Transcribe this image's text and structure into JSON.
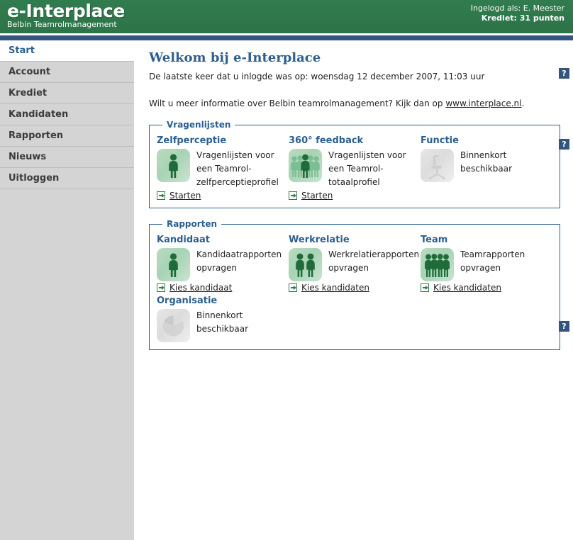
{
  "header": {
    "brand_title": "e-Interplace",
    "brand_subtitle": "Belbin Teamrolmanagement",
    "session_user": "Ingelogd als: E. Meester",
    "session_credit": "Krediet: 31 punten",
    "accent_green": "#2f7a4d",
    "accent_blue": "#33557f"
  },
  "sidebar": {
    "items": [
      {
        "label": "Start",
        "active": true
      },
      {
        "label": "Account",
        "active": false
      },
      {
        "label": "Krediet",
        "active": false
      },
      {
        "label": "Kandidaten",
        "active": false
      },
      {
        "label": "Rapporten",
        "active": false
      },
      {
        "label": "Nieuws",
        "active": false
      },
      {
        "label": "Uitloggen",
        "active": false
      }
    ]
  },
  "main": {
    "page_title": "Welkom bij e-Interplace",
    "last_login": "De laatste keer dat u inlogde was op: woensdag 12 december 2007, 11:03 uur",
    "info_prefix": "Wilt u meer informatie over Belbin teamrolmanagement? Kijk dan op ",
    "info_link": "www.interplace.nl",
    "info_suffix": ".",
    "help_label": "?"
  },
  "questionnaires": {
    "legend": "Vragenlijsten",
    "cards": [
      {
        "title": "Zelfperceptie",
        "text": "Vragenlijsten voor een Teamrol-zelfperceptieprofiel",
        "link": "Starten",
        "icon": "single-person-icon",
        "enabled": true
      },
      {
        "title": "360° feedback",
        "text": "Vragenlijsten voor een Teamrol-totaalprofiel",
        "link": "Starten",
        "icon": "group-person-icon",
        "enabled": true
      },
      {
        "title": "Functie",
        "text": "Binnenkort beschikbaar",
        "link": "",
        "icon": "office-chair-icon",
        "enabled": false
      }
    ]
  },
  "reports": {
    "legend": "Rapporten",
    "cards": [
      {
        "title": "Kandidaat",
        "text": "Kandidaatrapporten opvragen",
        "link": "Kies kandidaat",
        "icon": "single-person-icon",
        "enabled": true
      },
      {
        "title": "Werkrelatie",
        "text": "Werkrelatierapporten opvragen",
        "link": "Kies kandidaten",
        "icon": "two-persons-icon",
        "enabled": true
      },
      {
        "title": "Team",
        "text": "Teamrapporten opvragen",
        "link": "Kies kandidaten",
        "icon": "four-persons-icon",
        "enabled": true
      }
    ],
    "organisation": {
      "title": "Organisatie",
      "text": "Binnenkort beschikbaar",
      "link": "",
      "icon": "pie-chart-icon",
      "enabled": false
    }
  }
}
